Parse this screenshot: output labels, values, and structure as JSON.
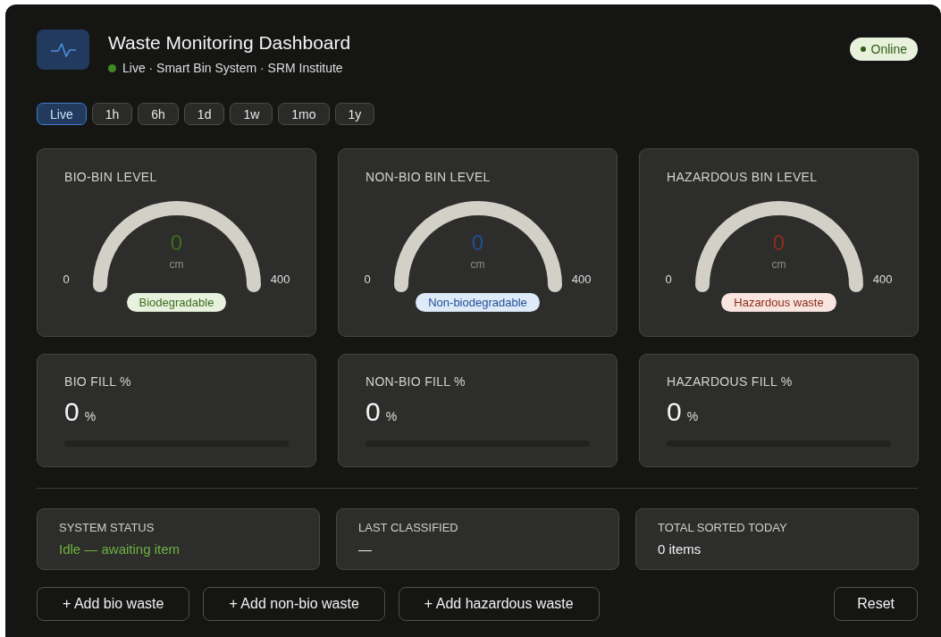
{
  "header": {
    "title": "Waste Monitoring Dashboard",
    "subtitle": "Live · Smart Bin System · SRM Institute",
    "status_badge": "Online"
  },
  "time_ranges": [
    {
      "label": "Live",
      "selected": true
    },
    {
      "label": "1h",
      "selected": false
    },
    {
      "label": "6h",
      "selected": false
    },
    {
      "label": "1d",
      "selected": false
    },
    {
      "label": "1w",
      "selected": false
    },
    {
      "label": "1mo",
      "selected": false
    },
    {
      "label": "1y",
      "selected": false
    }
  ],
  "gauges": [
    {
      "title": "BIO-BIN LEVEL",
      "value": "0",
      "unit": "cm",
      "min": "0",
      "max": "400",
      "tag": "Biodegradable",
      "color": "#3b6d1e"
    },
    {
      "title": "NON-BIO BIN LEVEL",
      "value": "0",
      "unit": "cm",
      "min": "0",
      "max": "400",
      "tag": "Non-biodegradable",
      "color": "#1f4f95"
    },
    {
      "title": "HAZARDOUS BIN LEVEL",
      "value": "0",
      "unit": "cm",
      "min": "0",
      "max": "400",
      "tag": "Hazardous waste",
      "color": "#8c2d1b"
    }
  ],
  "fills": [
    {
      "title": "BIO FILL %",
      "value": "0",
      "unit": "%",
      "level": 0
    },
    {
      "title": "NON-BIO FILL %",
      "value": "0",
      "unit": "%",
      "level": 0
    },
    {
      "title": "HAZARDOUS FILL %",
      "value": "0",
      "unit": "%",
      "level": 0
    }
  ],
  "stats": [
    {
      "title": "SYSTEM STATUS",
      "value": "Idle — awaiting item",
      "kind": "status"
    },
    {
      "title": "LAST CLASSIFIED",
      "value": "—",
      "kind": "plain"
    },
    {
      "title": "TOTAL SORTED TODAY",
      "value": "0 items",
      "kind": "plain"
    }
  ],
  "actions": [
    "+ Add bio waste",
    "+ Add non-bio waste",
    "+ Add hazardous waste"
  ],
  "reset": "Reset"
}
